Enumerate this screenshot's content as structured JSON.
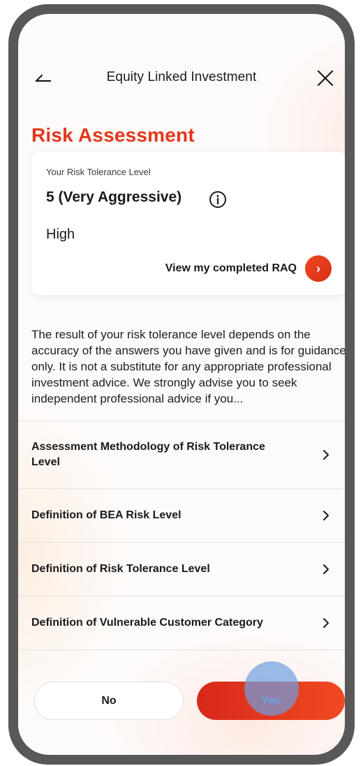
{
  "header": {
    "title": "Equity Linked Investment"
  },
  "page": {
    "title": "Risk Assessment"
  },
  "risk_card": {
    "label": "Your Risk Tolerance Level",
    "level": "5 (Very Aggressive)",
    "risk": "High",
    "link_label": "View my completed RAQ",
    "link_arrow": "›"
  },
  "disclaimer": "The result of your risk tolerance level depends on the accuracy of the answers you have given and is for guidance only. It is not a substitute for any appropriate professional investment advice. We strongly advise you to seek independent professional advice if you...",
  "list": {
    "items": [
      {
        "label": "Assessment Methodology of Risk Tolerance Level"
      },
      {
        "label": "Definition of BEA Risk Level"
      },
      {
        "label": "Definition of Risk Tolerance Level"
      },
      {
        "label": "Definition of Vulnerable Customer Category"
      }
    ]
  },
  "actions": {
    "no_label": "No",
    "yes_label": "Yes"
  },
  "colors": {
    "accent": "#e2361b",
    "button_gradient_start": "#d8281a",
    "button_gradient_end": "#f04a22",
    "tap_indicator": "#6ea0e1"
  },
  "icons": {
    "back": "back-arrow-icon",
    "close": "close-icon",
    "info": "info-icon",
    "chevron": "chevron-right-icon"
  }
}
